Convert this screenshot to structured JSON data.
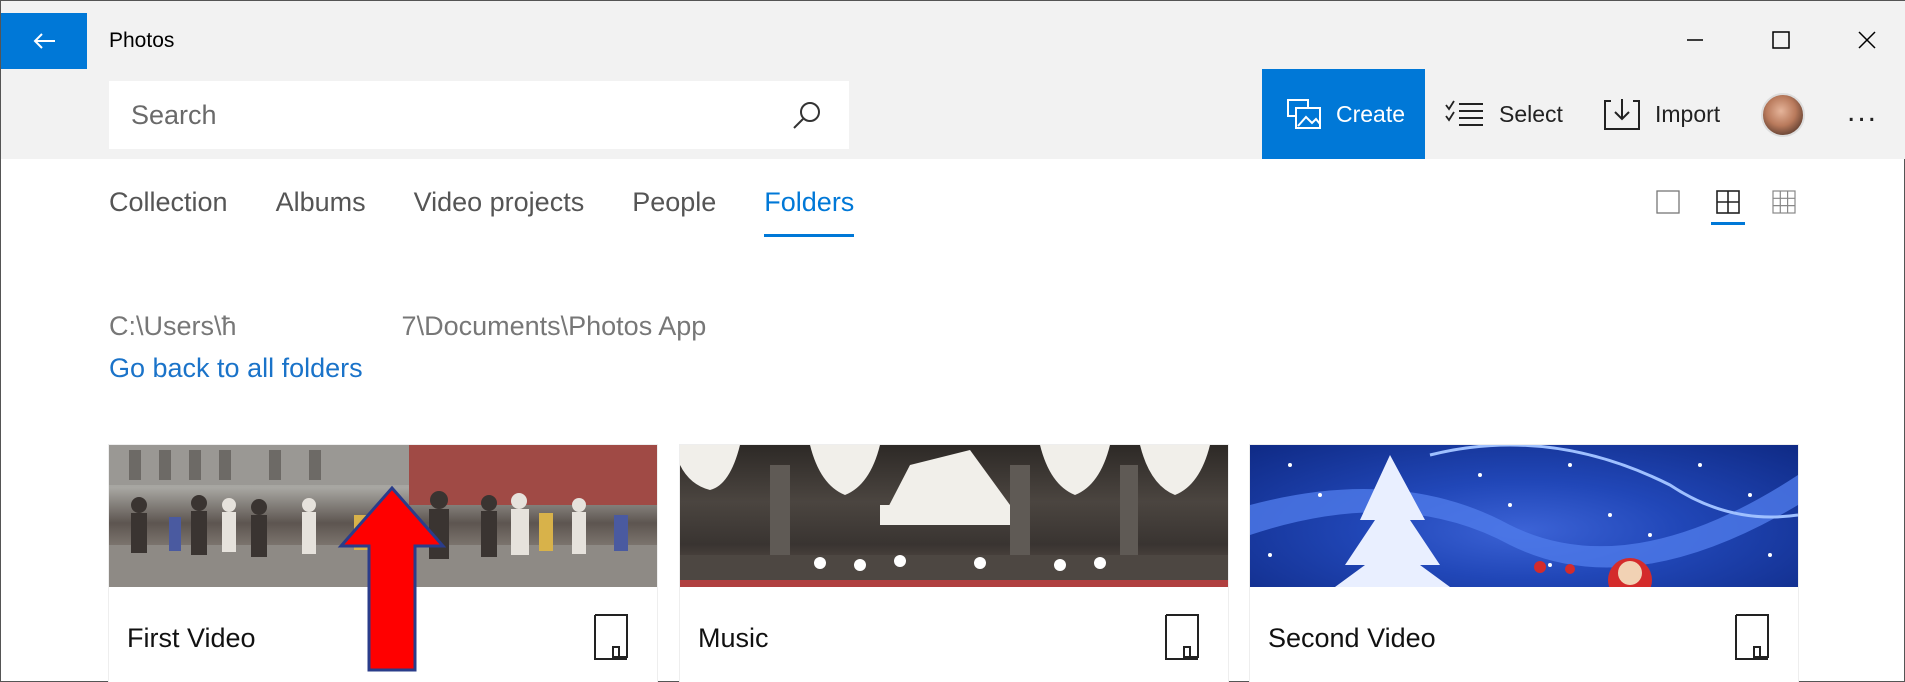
{
  "app": {
    "title": "Photos"
  },
  "search": {
    "placeholder": "Search"
  },
  "commands": {
    "create": "Create",
    "select": "Select",
    "import": "Import",
    "more": "..."
  },
  "tabs": [
    {
      "label": "Collection"
    },
    {
      "label": "Albums"
    },
    {
      "label": "Video projects"
    },
    {
      "label": "People"
    },
    {
      "label": "Folders",
      "active": true
    }
  ],
  "path": {
    "text": "C:\\Users\\ħ                      7\\Documents\\Photos App",
    "back_link": "Go back to all folders"
  },
  "folders": [
    {
      "name": "First Video"
    },
    {
      "name": "Music"
    },
    {
      "name": "Second Video"
    }
  ],
  "colors": {
    "accent": "#0078d7",
    "annotation_arrow": "#ff0000"
  }
}
